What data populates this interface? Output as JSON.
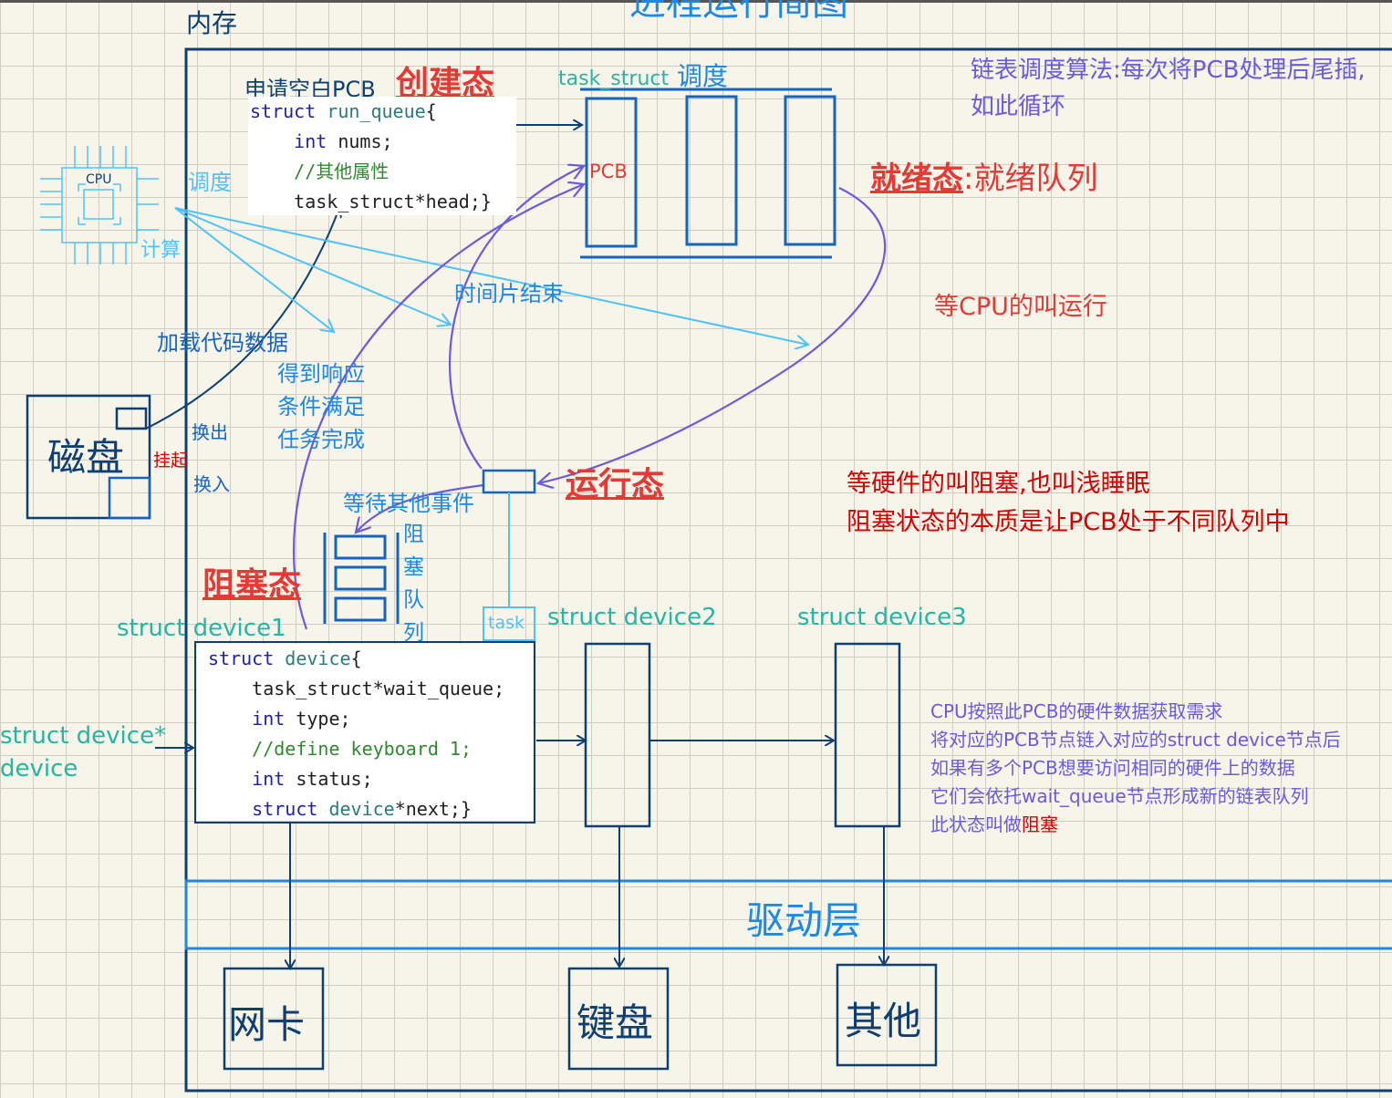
{
  "title_partial": "进程运行简图",
  "memory_label": "内存",
  "cpu": {
    "chip_label": "CPU",
    "schedule": "调度",
    "compute": "计算"
  },
  "disk": {
    "label": "磁盘",
    "swap_out": "换出",
    "suspend": "挂起",
    "swap_in": "换入"
  },
  "create_state": {
    "request": "申请空白PCB",
    "title": "创建态"
  },
  "run_queue_code": [
    "struct run_queue{",
    "    int nums;",
    "    //其他属性",
    "    task_struct*head;}"
  ],
  "ready": {
    "task_struct": "task_struct",
    "schedule": "调度",
    "pcb": "PCB",
    "title": "就绪态",
    "subtitle": ":就绪队列"
  },
  "linked_list_note": [
    "链表调度算法:每次将PCB处理后尾插,",
    "如此循环"
  ],
  "time_slice_end": "时间片结束",
  "load_code_data": "加载代码数据",
  "response_lines": [
    "得到响应",
    "条件满足",
    "任务完成"
  ],
  "wait_cpu_run": "等CPU的叫运行",
  "running": {
    "title": "运行态",
    "wait_event": "等待其他事件"
  },
  "blocked": {
    "title": "阻塞态",
    "queue_chars": [
      "阻",
      "塞",
      "队",
      "列"
    ]
  },
  "blocking_note": [
    "等硬件的叫阻塞,也叫浅睡眠",
    "阻塞状态的本质是让PCB处于不同队列中"
  ],
  "task_label": "task",
  "devices": {
    "d1": "struct device1",
    "d2": "struct device2",
    "d3": "struct device3"
  },
  "struct_device_ptr": [
    "struct device*",
    "device"
  ],
  "device_code": [
    "struct device{",
    "    task_struct*wait_queue;",
    "    int type;",
    "    //define keyboard 1;",
    "    int status;",
    "    struct device*next;}"
  ],
  "cpu_note": [
    "CPU按照此PCB的硬件数据获取需求",
    "将对应的PCB节点链入对应的struct device节点后",
    "如果有多个PCB想要访问相同的硬件上的数据",
    "它们会依托wait_queue节点形成新的链表队列",
    "此状态叫做"
  ],
  "cpu_note_highlight": "阻塞",
  "driver_layer": "驱动层",
  "hardware": {
    "nic": "网卡",
    "keyboard": "键盘",
    "other": "其他"
  },
  "colors": {
    "blue": "#1565c0",
    "navy": "#0d3f73",
    "cyan": "#4fc3f7",
    "red": "#e53935",
    "purple": "#6a5ae0",
    "teal": "#26b5a3"
  }
}
